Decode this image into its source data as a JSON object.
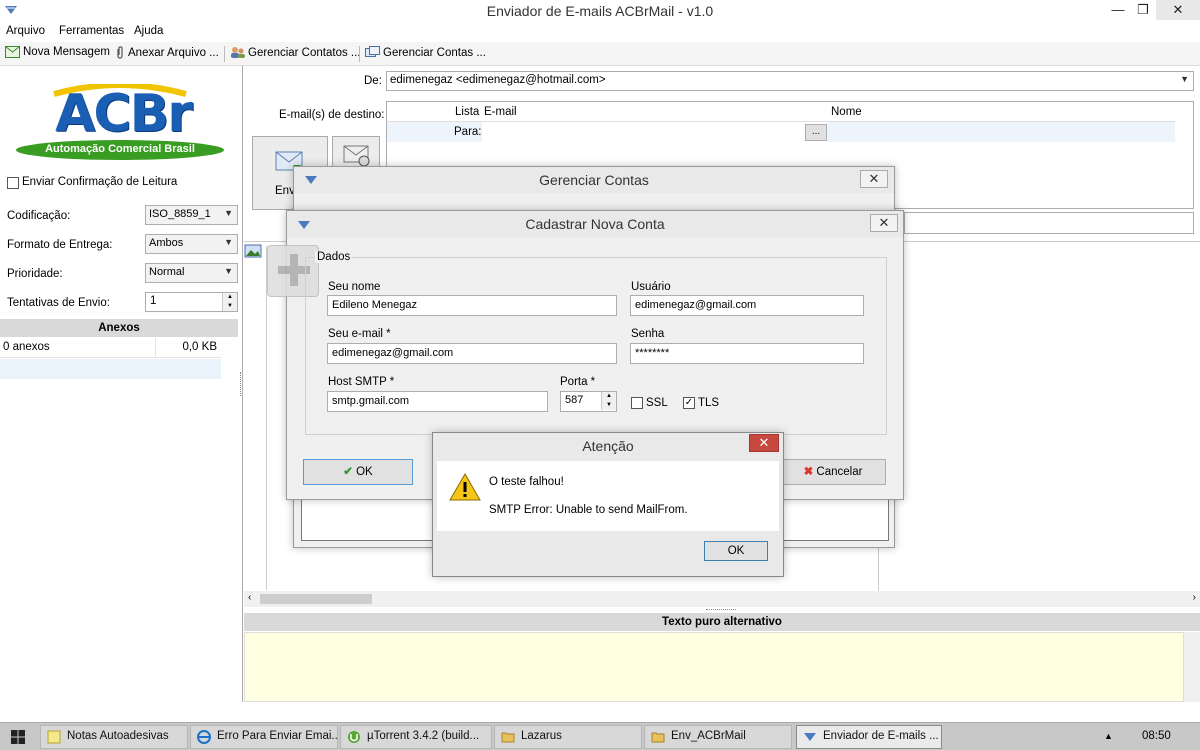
{
  "window": {
    "title": "Enviador de E-mails ACBrMail - v1.0",
    "minimize": "—",
    "maximize": "❐",
    "close": "✕"
  },
  "menu": [
    "Arquivo",
    "Ferramentas",
    "Ajuda"
  ],
  "toolbar": {
    "new_message": "Nova Mensagem",
    "attach_file": "Anexar Arquivo ...",
    "manage_contacts": "Gerenciar Contatos ...",
    "manage_accounts": "Gerenciar Contas ..."
  },
  "left": {
    "logo_text": "ACBr",
    "logo_sub": "Automação Comercial Brasil",
    "read_receipt": "Enviar Confirmação de Leitura",
    "encoding_label": "Codificação:",
    "encoding_value": "ISO_8859_1",
    "delivery_label": "Formato de Entrega:",
    "delivery_value": "Ambos",
    "priority_label": "Prioridade:",
    "priority_value": "Normal",
    "attempts_label": "Tentativas de Envio:",
    "attempts_value": "1",
    "attachments_header": "Anexos",
    "attachments_count": "0 anexos",
    "attachments_size": "0,0 KB"
  },
  "compose": {
    "from_label": "De:",
    "from_value": "edimenegaz <edimenegaz@hotmail.com>",
    "dest_label": "E-mail(s) de destino:",
    "col_list": "Lista",
    "col_email": "E-mail",
    "col_name": "Nome",
    "row_to": "Para:",
    "row_btn": "...",
    "send_label": "Env",
    "plain_text_header": "Texto puro alternativo"
  },
  "manage_accounts_dialog": {
    "title": "Gerenciar Contas",
    "close": "✕"
  },
  "new_account_dialog": {
    "title": "Cadastrar Nova Conta",
    "close": "✕",
    "group": "Dados",
    "name_label": "Seu nome",
    "name_value": "Edileno Menegaz",
    "user_label": "Usuário",
    "user_value": "edimenegaz@gmail.com",
    "email_label": "Seu e-mail *",
    "email_value": "edimenegaz@gmail.com",
    "password_label": "Senha",
    "password_value": "********",
    "host_label": "Host SMTP *",
    "host_value": "smtp.gmail.com",
    "port_label": "Porta *",
    "port_value": "587",
    "ssl_label": "SSL",
    "tls_label": "TLS",
    "ok_label": "OK",
    "cancel_label": "Cancelar"
  },
  "alert_dialog": {
    "title": "Atenção",
    "close": "✕",
    "line1": "O teste falhou!",
    "line2": "SMTP Error: Unable to send MailFrom.",
    "ok_label": "OK"
  },
  "taskbar": {
    "items": [
      "Notas Autoadesivas",
      "Erro Para Enviar Emai...",
      "µTorrent 3.4.2  (build...",
      "Lazarus",
      "Env_ACBrMail",
      "Enviador de E-mails ..."
    ],
    "tray_arrow": "▲",
    "clock": "08:50"
  },
  "colors": {
    "logo_blue": "#1a5fb4",
    "logo_yellow": "#f2c400",
    "logo_green": "#3a9d23",
    "alert_close": "#c7483f",
    "plain_text_bg": "#ffffe1"
  }
}
